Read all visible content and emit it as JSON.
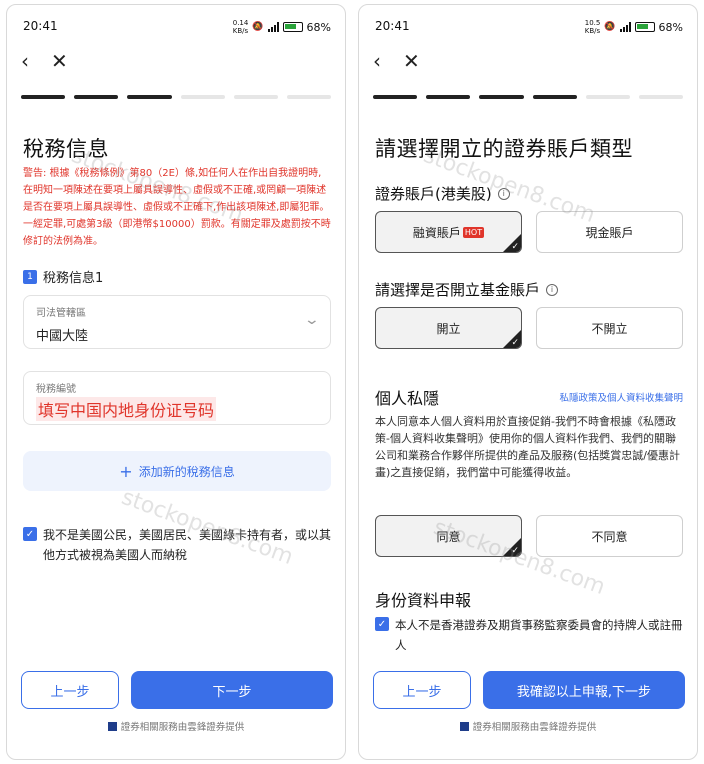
{
  "status_left": {
    "time": "20:41",
    "speed": "0.14\nKB/s",
    "battery": "68%"
  },
  "status_right": {
    "time": "20:41",
    "speed": "10.5\nKB/s",
    "battery": "68%"
  },
  "nav": {
    "back_icon": "chevron-left-icon",
    "close_icon": "close-icon"
  },
  "left": {
    "progress": {
      "total": 6,
      "done": 3
    },
    "title": "稅務信息",
    "warning": "警告: 根據《稅務條例》第80（2E）條,如任何人在作出自我證明時,在明知一項陳述在要項上屬具誤導性、虛假或不正確,或罔顧一項陳述是否在要項上屬具誤導性、虛假或不正確下,作出該項陳述,即屬犯罪。一經定罪,可處第3級（即港幣$10000）罰款。有關定罪及處罰按不時修訂的法例為准。",
    "section_num": "1",
    "section_title": "稅務信息1",
    "jurisdiction_label": "司法管轄區",
    "jurisdiction_value": "中國大陸",
    "tax_id_label": "稅務編號",
    "tax_id_value": "填写中国内地身份证号码",
    "add_button": "添加新的稅務信息",
    "checkbox_text": "我不是美國公民，美國居民、美國綠卡持有者，或以其他方式被視為美國人而納稅",
    "prev_button": "上一步",
    "next_button": "下一步",
    "footer": "證券相關服務由雲鋒證券提供"
  },
  "right": {
    "progress": {
      "total": 6,
      "done": 4
    },
    "title": "請選擇開立的證券賬戶類型",
    "account_label": "證券賬戶(港美股)",
    "account_options": [
      "融資賬戶",
      "現金賬戶"
    ],
    "hot_badge": "HOT",
    "fund_label": "請選擇是否開立基金賬戶",
    "fund_options": [
      "開立",
      "不開立"
    ],
    "privacy_title": "個人私隱",
    "privacy_link": "私隱政策及個人資料收集聲明",
    "privacy_text": "本人同意本人個人資料用於直接促銷-我們不時會根據《私隱政策-個人資料收集聲明》使用你的個人資料作我們、我們的關聯公司和業務合作夥伴所提供的產品及服務(包括獎賞忠誠/優惠計畫)之直接促銷，我們當中可能獲得收益。",
    "consent_options": [
      "同意",
      "不同意"
    ],
    "declaration_title": "身份資料申報",
    "declaration_text": "本人不是香港證券及期貨事務監察委員會的持牌人或註冊人",
    "prev_button": "上一步",
    "confirm_button": "我確認以上申報,下一步",
    "footer": "證券相關服務由雲鋒證券提供"
  },
  "watermark": "stockopen8.com",
  "colors": {
    "accent": "#3a6fe8",
    "warning": "#e0352b"
  }
}
